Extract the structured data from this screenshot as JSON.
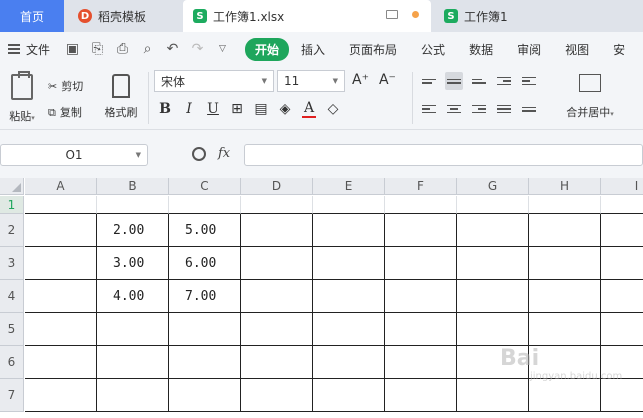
{
  "tabs": {
    "home": "首页",
    "template": "稻壳模板",
    "active": "工作簿1.xlsx",
    "other": "工作簿1"
  },
  "menu": {
    "file": "文件",
    "items": [
      "开始",
      "插入",
      "页面布局",
      "公式",
      "数据",
      "审阅",
      "视图",
      "安"
    ]
  },
  "ribbon": {
    "paste": "粘贴",
    "cut": "剪切",
    "copy": "复制",
    "format_painter": "格式刷",
    "font_name": "宋体",
    "font_size": "11",
    "merge": "合并居中"
  },
  "formula_bar": {
    "cell_ref": "O1",
    "fx": "fx",
    "content": ""
  },
  "sheet": {
    "columns": [
      "A",
      "B",
      "C",
      "D",
      "E",
      "F",
      "G",
      "H",
      "I"
    ],
    "rows": [
      "1",
      "2",
      "3",
      "4",
      "5",
      "6",
      "7"
    ],
    "cells": {
      "B2": "2.00",
      "C2": "5.00",
      "B3": "3.00",
      "C3": "6.00",
      "B4": "4.00",
      "C4": "7.00"
    }
  },
  "watermark": {
    "brand": "Bai",
    "sub": "jingyan.baidu.com"
  },
  "colors": {
    "accent": "#1ea65c",
    "home_tab": "#4a7ff0"
  }
}
